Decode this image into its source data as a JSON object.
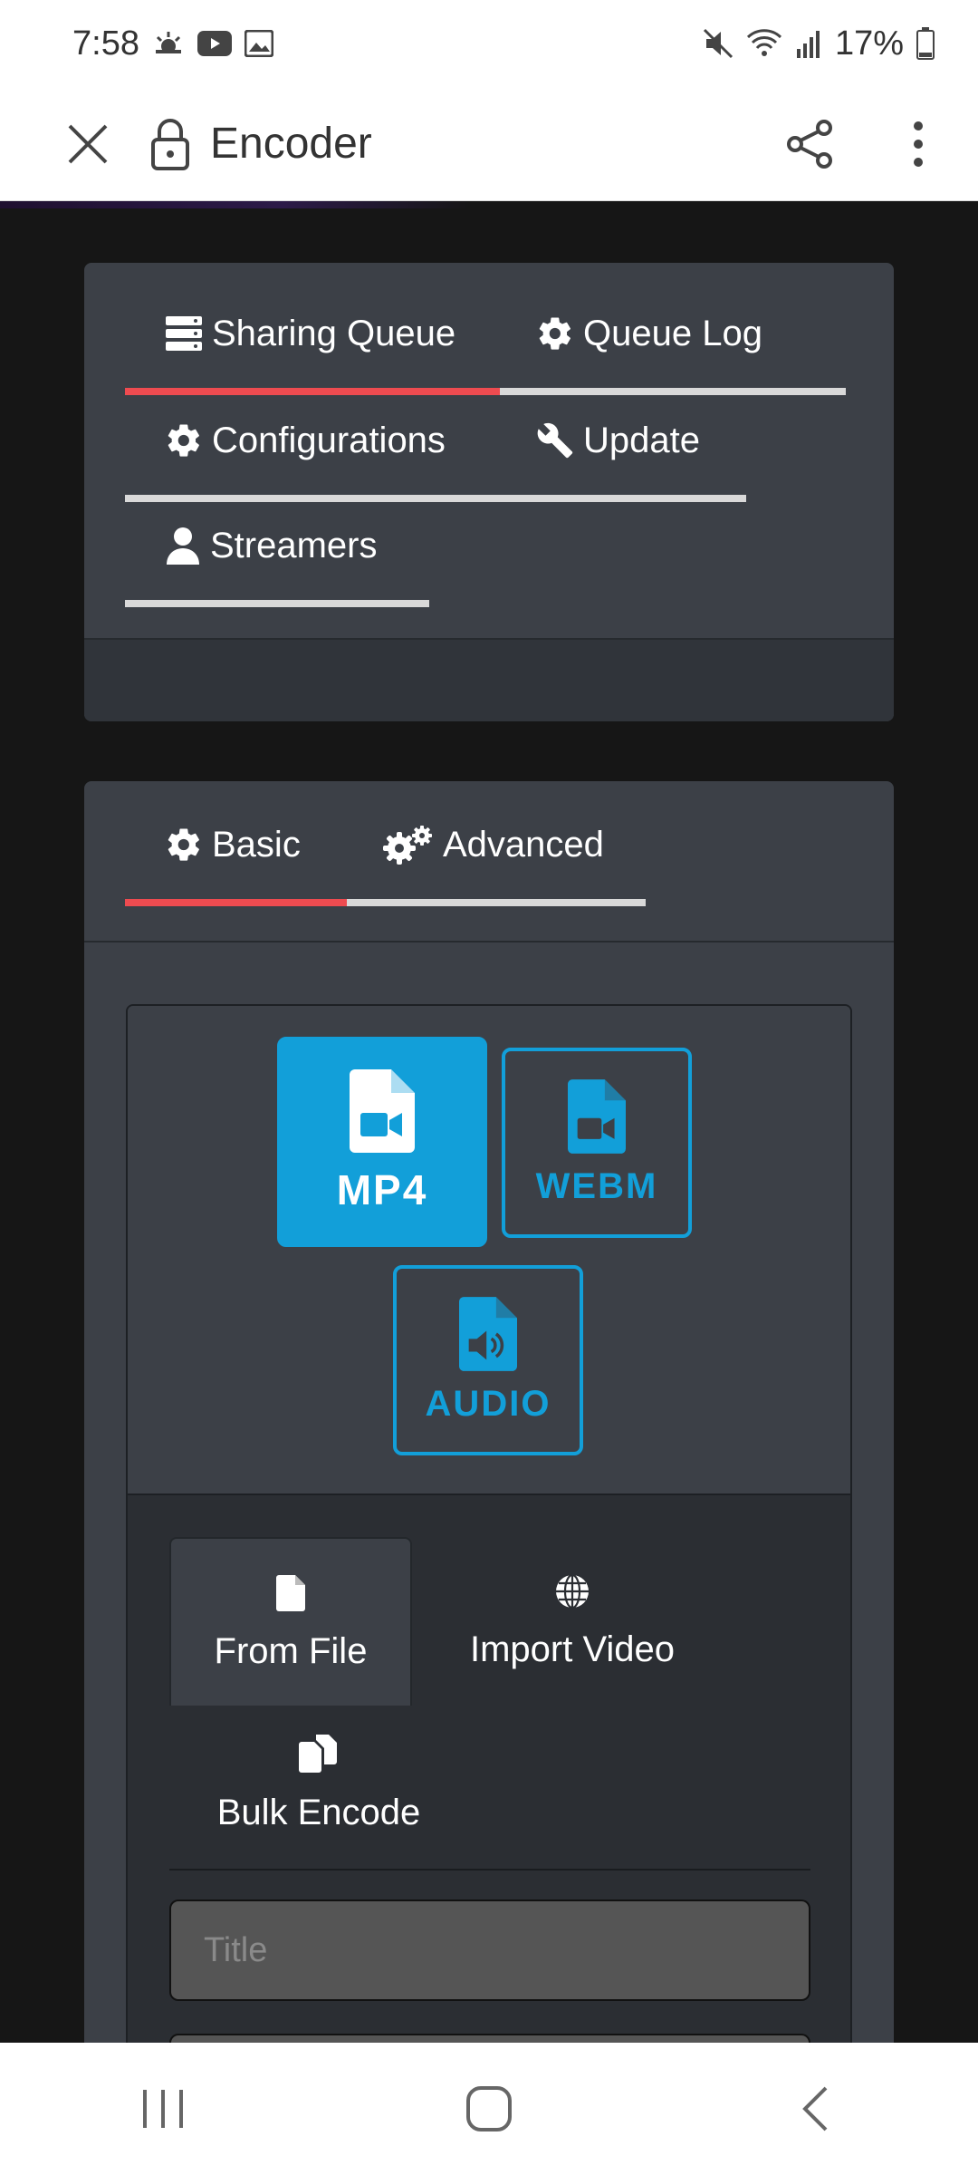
{
  "status_bar": {
    "time": "7:58",
    "battery": "17%"
  },
  "browser": {
    "title": "Encoder"
  },
  "top_tabs": [
    {
      "label": "Sharing Queue",
      "icon": "server-icon",
      "active": true
    },
    {
      "label": "Queue Log",
      "icon": "gear-icon",
      "active": false
    },
    {
      "label": "Configurations",
      "icon": "gear-icon",
      "active": false
    },
    {
      "label": "Update",
      "icon": "wrench-icon",
      "active": false
    },
    {
      "label": "Streamers",
      "icon": "user-icon",
      "active": false
    }
  ],
  "settings_tabs": [
    {
      "label": "Basic",
      "icon": "gear-icon",
      "active": true
    },
    {
      "label": "Advanced",
      "icon": "gears-icon",
      "active": false
    }
  ],
  "formats": [
    {
      "label": "MP4",
      "icon": "file-video-icon",
      "selected": true
    },
    {
      "label": "WEBM",
      "icon": "file-video-icon",
      "selected": false
    },
    {
      "label": "AUDIO",
      "icon": "file-audio-icon",
      "selected": false
    }
  ],
  "sources": [
    {
      "label": "From File",
      "icon": "file-icon",
      "active": true
    },
    {
      "label": "Import Video",
      "icon": "globe-icon",
      "active": false
    },
    {
      "label": "Bulk Encode",
      "icon": "copy-icon",
      "active": false
    }
  ],
  "form": {
    "title_placeholder": "Title"
  },
  "colors": {
    "accent_red": "#ee4b50",
    "accent_blue": "#129fd9",
    "panel": "#3c4047",
    "background": "#161616"
  }
}
